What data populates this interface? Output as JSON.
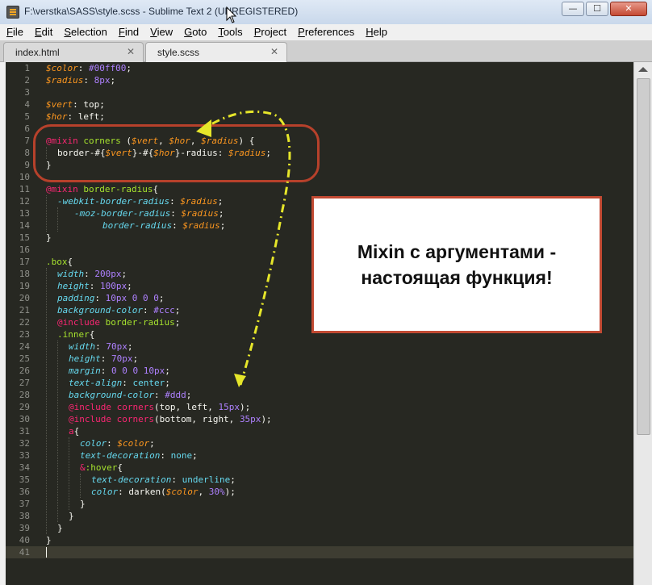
{
  "window": {
    "title": "F:\\verstka\\SASS\\style.scss - Sublime Text 2 (UNREGISTERED)",
    "buttons": {
      "minimize": "—",
      "maximize": "☐",
      "close": "✕"
    }
  },
  "menu": [
    "File",
    "Edit",
    "Selection",
    "Find",
    "View",
    "Goto",
    "Tools",
    "Project",
    "Preferences",
    "Help"
  ],
  "tabs": [
    {
      "label": "index.html",
      "close": "✕"
    },
    {
      "label": "style.scss",
      "close": "✕"
    }
  ],
  "line_numbers": [
    "1",
    "2",
    "3",
    "4",
    "5",
    "6",
    "7",
    "8",
    "9",
    "10",
    "11",
    "12",
    "13",
    "14",
    "15",
    "16",
    "17",
    "18",
    "19",
    "20",
    "21",
    "22",
    "23",
    "24",
    "25",
    "26",
    "27",
    "28",
    "29",
    "30",
    "31",
    "32",
    "33",
    "34",
    "35",
    "36",
    "37",
    "38",
    "39",
    "40",
    "41"
  ],
  "code": {
    "l1": [
      "$color",
      ": ",
      "#00ff00",
      ";"
    ],
    "l2": [
      "$radius",
      ": ",
      "8px",
      ";"
    ],
    "l4": [
      "$vert",
      ": top;"
    ],
    "l5": [
      "$hor",
      ": left;"
    ],
    "l7": [
      "@mixin",
      " corners",
      " (",
      "$vert",
      ", ",
      "$hor",
      ", ",
      "$radius",
      ") {"
    ],
    "l8": [
      "border-#{",
      "$vert",
      "}-#{",
      "$hor",
      "}-radius: ",
      "$radius",
      ";"
    ],
    "l9": [
      "}"
    ],
    "l11": [
      "@mixin",
      " border-radius",
      "{"
    ],
    "l12": [
      "-webkit-border-radius",
      ": ",
      "$radius",
      ";"
    ],
    "l13": [
      "-moz-border-radius",
      ": ",
      "$radius",
      ";"
    ],
    "l14": [
      "border-radius",
      ": ",
      "$radius",
      ";"
    ],
    "l15": [
      "}"
    ],
    "l17": [
      ".box",
      "{"
    ],
    "l18": [
      "width",
      ": ",
      "200px",
      ";"
    ],
    "l19": [
      "height",
      ": ",
      "100px",
      ";"
    ],
    "l20": [
      "padding",
      ": ",
      "10px 0 0 0",
      ";"
    ],
    "l21": [
      "background-color",
      ": ",
      "#ccc",
      ";"
    ],
    "l22": [
      "@include",
      " border-radius",
      ";"
    ],
    "l23": [
      ".inner",
      "{"
    ],
    "l24": [
      "width",
      ": ",
      "70px",
      ";"
    ],
    "l25": [
      "height",
      ": ",
      "70px",
      ";"
    ],
    "l26": [
      "margin",
      ": ",
      "0 0 0 10px",
      ";"
    ],
    "l27": [
      "text-align",
      ": ",
      "center",
      ";"
    ],
    "l28": [
      "background-color",
      ": ",
      "#ddd",
      ";"
    ],
    "l29": [
      "@include",
      " corners",
      "(top, left, ",
      "15px",
      ");"
    ],
    "l30": [
      "@include",
      " corners",
      "(bottom, right, ",
      "35px",
      ");"
    ],
    "l31": [
      "a",
      "{"
    ],
    "l32": [
      "color",
      ": ",
      "$color",
      ";"
    ],
    "l33": [
      "text-decoration",
      ": ",
      "none",
      ";"
    ],
    "l34": [
      "&",
      ":hover",
      "{"
    ],
    "l35": [
      "text-decoration",
      ": ",
      "underline",
      ";"
    ],
    "l36": [
      "color",
      ": darken(",
      "$color",
      ", ",
      "30%",
      ");"
    ],
    "l37": [
      "}"
    ],
    "l38": [
      "}"
    ],
    "l39": [
      "}"
    ],
    "l40": [
      "}"
    ]
  },
  "annotation": {
    "line1": "Mixin с аргументами -",
    "line2": "настоящая функция!"
  },
  "colors": {
    "editor_bg": "#272822",
    "accent_red": "#c24a33",
    "arrow_yellow": "#e6e62a"
  }
}
